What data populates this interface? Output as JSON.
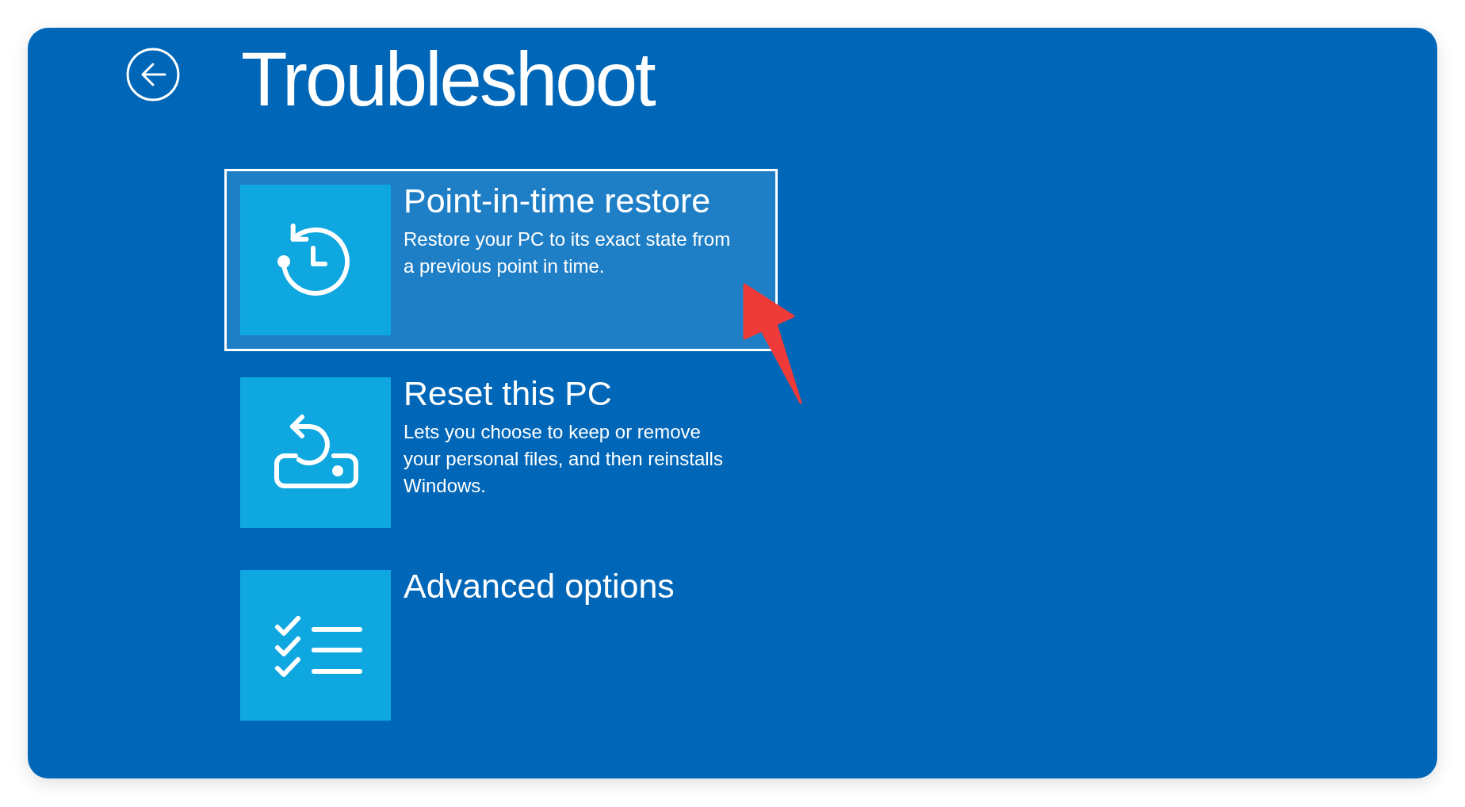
{
  "header": {
    "title": "Troubleshoot"
  },
  "options": [
    {
      "title": "Point-in-time restore",
      "description": "Restore your PC to its exact state from a previous point in time.",
      "selected": true
    },
    {
      "title": "Reset this PC",
      "description": "Lets you choose to keep or remove your personal files, and then reinstalls Windows.",
      "selected": false
    },
    {
      "title": "Advanced options",
      "selected": false
    }
  ]
}
